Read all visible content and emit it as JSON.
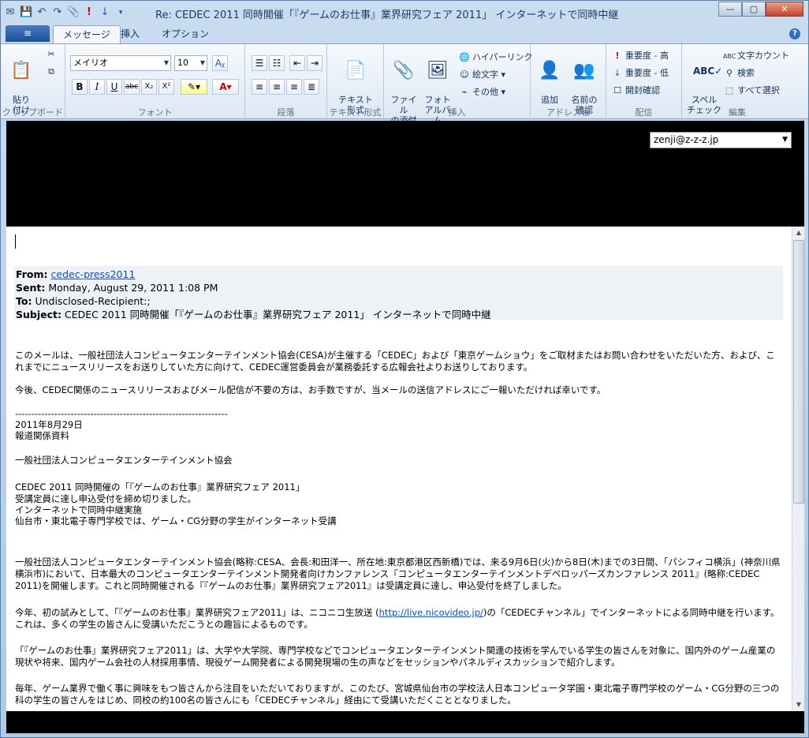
{
  "titlebar": {
    "title": "Re: CEDEC 2011 同時開催「『ゲームのお仕事』業界研究フェア 2011」 インターネットで同時中継",
    "minimize": "—",
    "maximize": "▢",
    "close": "✕"
  },
  "tabs": {
    "file": "≡",
    "message": "メッセージ",
    "insert": "挿入",
    "options": "オプション",
    "help": "?"
  },
  "ribbon": {
    "clipboard": {
      "paste": "貼り\n付け",
      "label": "クリップボード"
    },
    "font": {
      "name": "メイリオ",
      "size": "10",
      "label": "フォント",
      "bold": "B",
      "italic": "I",
      "underline": "U",
      "strike": "abc",
      "sub": "X₂",
      "sup": "X²"
    },
    "paragraph": {
      "label": "段落"
    },
    "textformat": {
      "button": "テキスト\n形式",
      "label": "テキスト形式"
    },
    "insert": {
      "attach": "ファイル\nの添付",
      "album": "フォト\nアルバム",
      "hyperlink": "ハイパーリンク",
      "emoji": "絵文字",
      "other": "その他",
      "label": "挿入"
    },
    "address": {
      "add": "追加",
      "check": "名前の\n確認",
      "label": "アドレス帳"
    },
    "delivery": {
      "high": "重要度 - 高",
      "low": "重要度 - 低",
      "read": "開封確認",
      "label": "配信"
    },
    "edit": {
      "spell": "スペル\nチェック",
      "count": "文字カウント",
      "search": "検索",
      "selectall": "すべて選択",
      "label": "編集"
    }
  },
  "header": {
    "from_account": "zenji@z-z-z.jp"
  },
  "message": {
    "from_label": "From:",
    "from_value": "cedec-press2011",
    "sent_label": "Sent:",
    "sent_value": "Monday, August 29, 2011 1:08 PM",
    "to_label": "To:",
    "to_value": "Undisclosed-Recipient:;",
    "subject_label": "Subject:",
    "subject_value": "CEDEC 2011 同時開催「『ゲームのお仕事』業界研究フェア 2011」 インターネットで同時中継",
    "p1": "このメールは、一般社団法人コンピュータエンターテインメント協会(CESA)が主催する「CEDEC」および「東京ゲームショウ」をご取材またはお問い合わせをいただいた方、および、これまでにニュースリリースをお送りしていた方に向けて、CEDEC運営委員会が業務委託する広報会社よりお送りしております。",
    "p2": "今後、CEDEC関係のニュースリリースおよびメール配信が不要の方は、お手数ですが、当メールの送信アドレスにご一報いただければ幸いです。",
    "divider": "-----------------------------------------------------------------",
    "date": "2011年8月29日",
    "doc_type": "報道関係資料",
    "org": "一般社団法人コンピュータエンターテインメント協会",
    "h1": "CEDEC 2011 同時開催の「『ゲームのお仕事』業界研究フェア 2011」",
    "h2": "受講定員に達し申込受付を締め切りました。",
    "h3": "インターネットで同時中継実施",
    "h4": "仙台市・東北電子専門学校では、ゲーム・CG分野の学生がインターネット受講",
    "p3": "一般社団法人コンピュータエンターテインメント協会(略称:CESA、会長:和田洋一、所在地:東京都港区西新橋)では、来る9月6日(火)から8日(木)までの3日間、「パシフィコ横浜」(神奈川県横浜市)において、日本最大のコンピュータエンターテインメント開発者向けカンファレンス『コンピュータエンターテインメントデベロッパーズカンファレンス 2011』(略称:CEDEC 2011)を開催します。これと同時開催される『『ゲームのお仕事』業界研究フェア2011』は受講定員に達し、申込受付を終了しました。",
    "p4a": "今年、初の試みとして、「『ゲームのお仕事』業界研究フェア2011」は、ニコニコ生放送 (",
    "p4link": "http://live.nicovideo.jp/",
    "p4b": ")の「CEDECチャンネル」でインターネットによる同時中継を行います。これは、多くの学生の皆さんに受講いただこうとの趣旨によるものです。",
    "p5": "「『ゲームのお仕事』業界研究フェア2011」は、大学や大学院、専門学校などでコンピュータエンターテインメント関連の技術を学んでいる学生の皆さんを対象に、国内外のゲーム産業の現状や将来、国内ゲーム会社の人材採用事情、現役ゲーム開発者による開発現場の生の声などをセッションやパネルディスカッションで紹介します。",
    "p6": "毎年、ゲーム業界で働く事に興味をもつ皆さんから注目をいただいておりますが、このたび、宮城県仙台市の学校法人日本コンピュータ学園・東北電子専門学校のゲーム・CG分野の三つの科の学生の皆さんをはじめ、同校の約100名の皆さんにも「CEDECチャンネル」経由にて受講いただくこととなりました。"
  }
}
